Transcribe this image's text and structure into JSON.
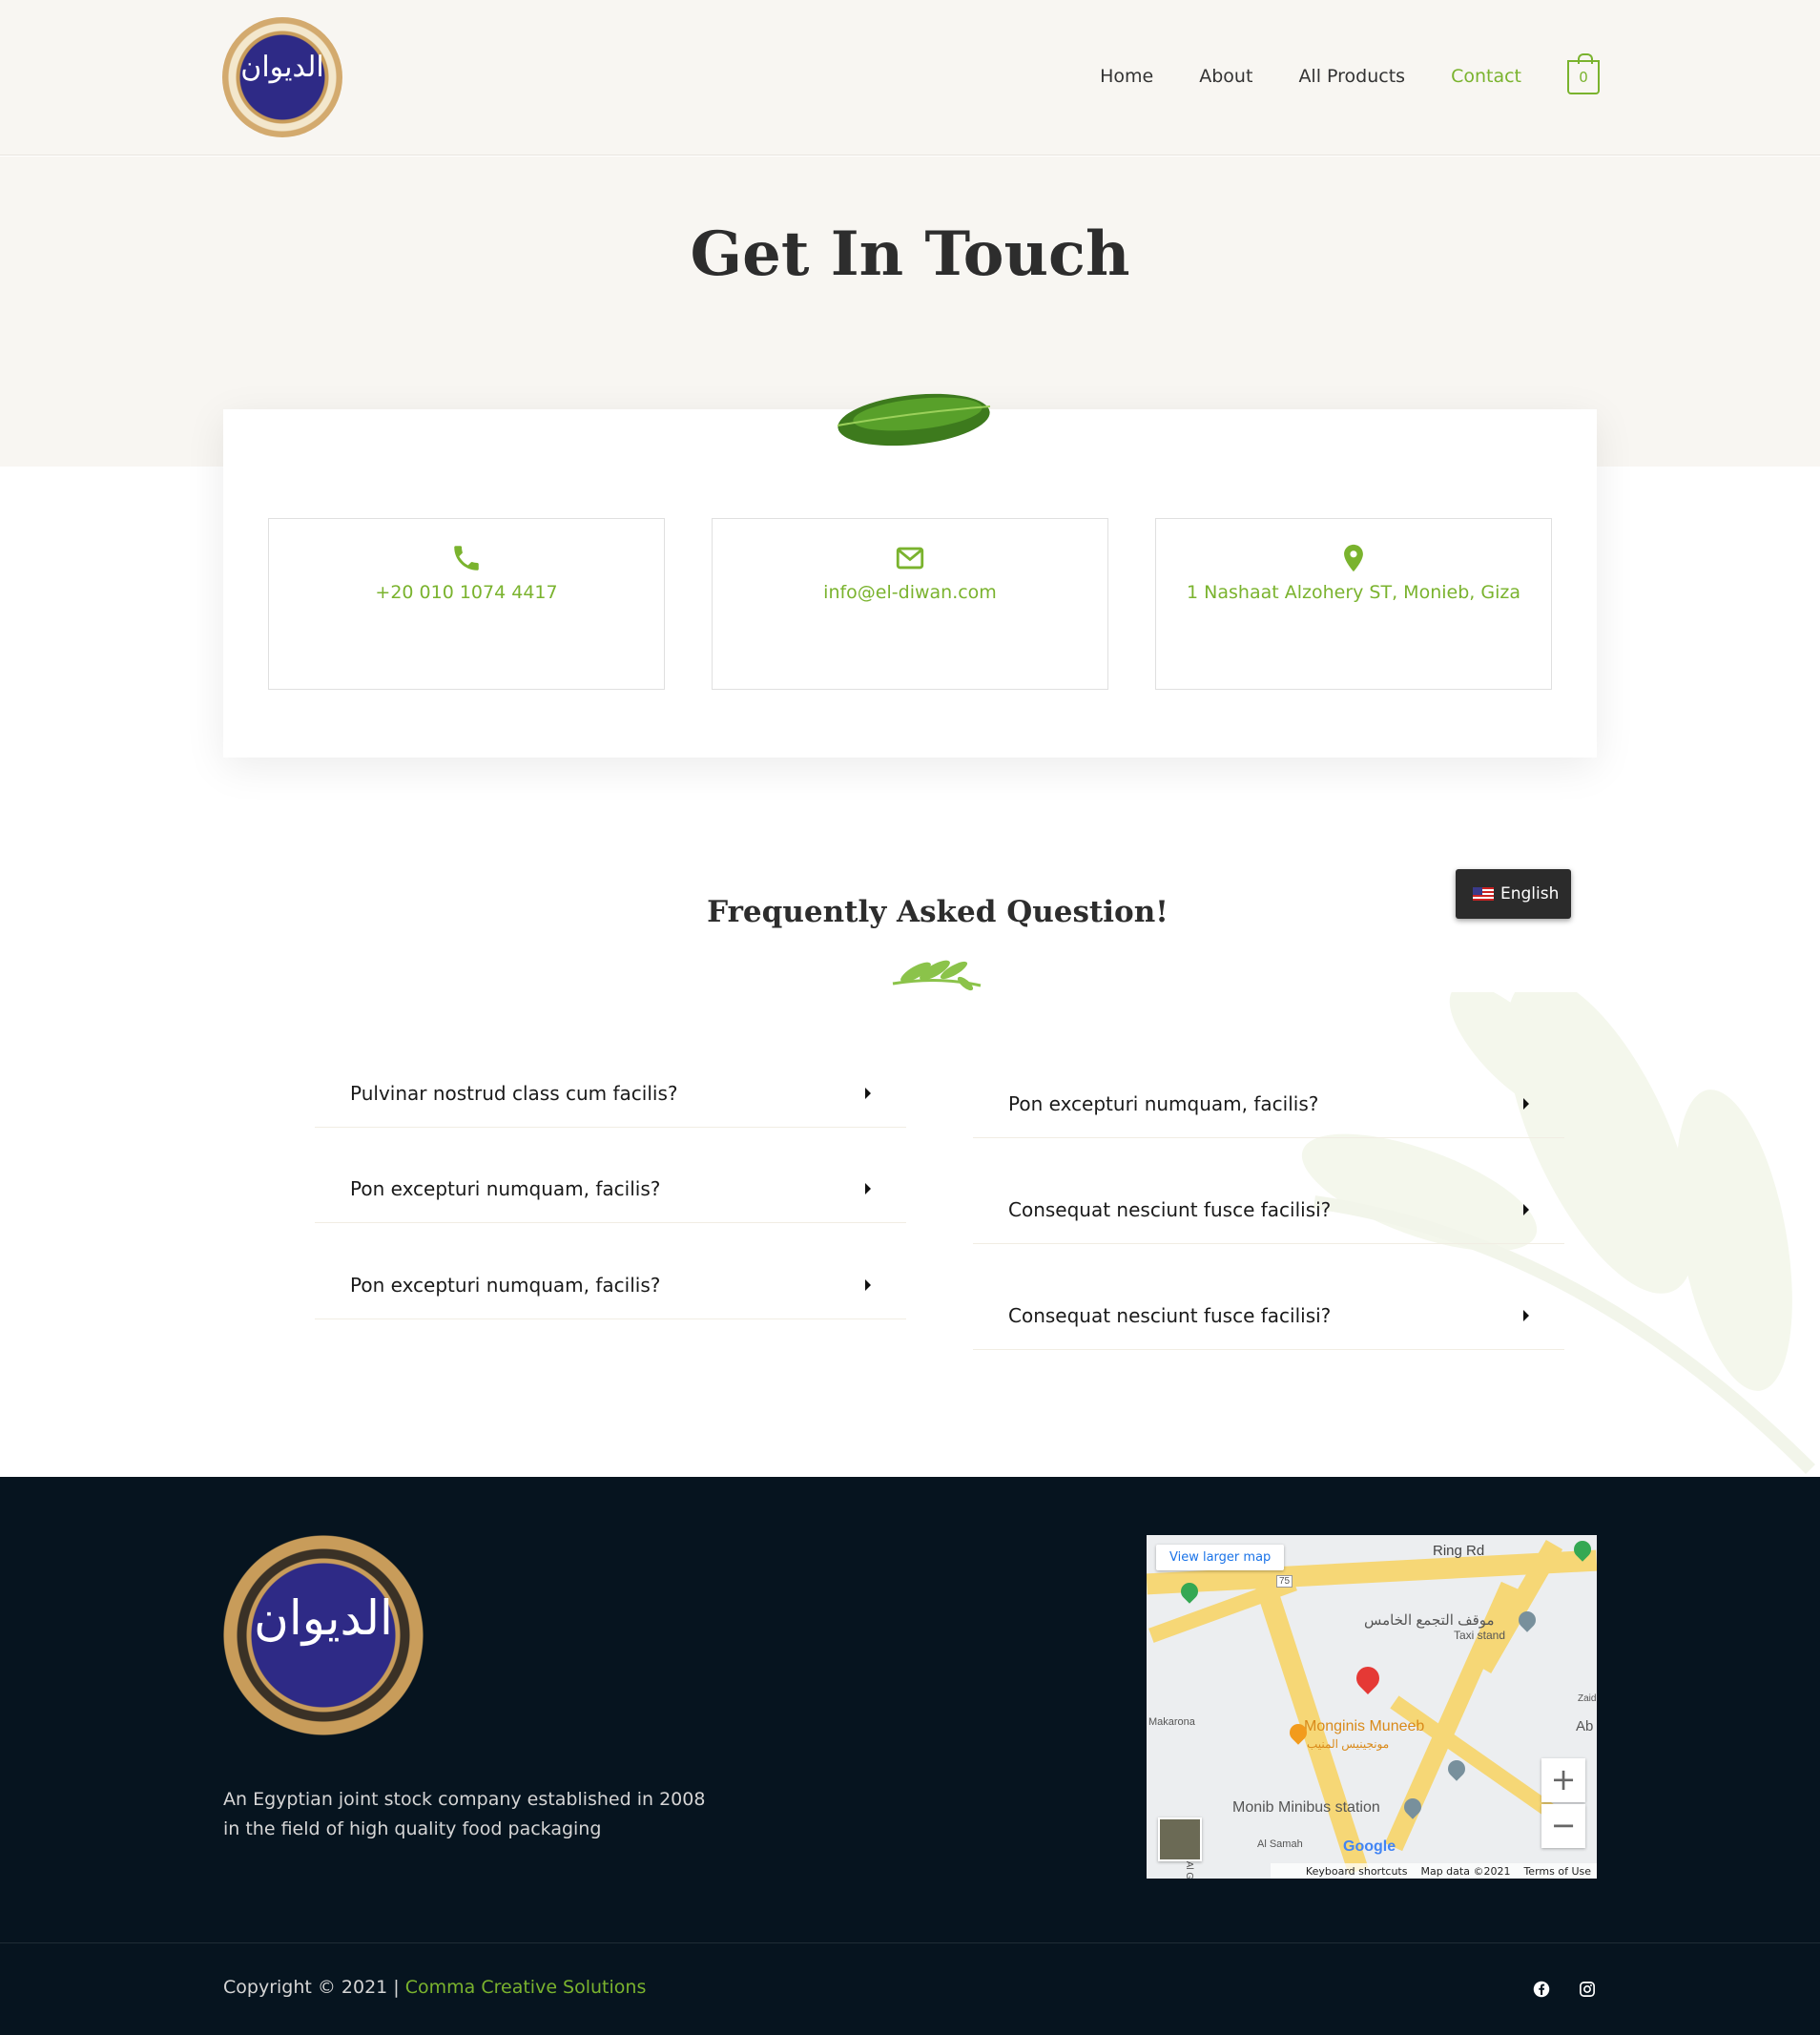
{
  "nav": {
    "items": [
      {
        "label": "Home"
      },
      {
        "label": "About"
      },
      {
        "label": "All Products"
      },
      {
        "label": "Contact"
      }
    ],
    "cart_count": "0"
  },
  "logo": {
    "text": "الديوان"
  },
  "hero": {
    "title": "Get In Touch"
  },
  "contact": {
    "phone": "+20 010 1074 4417",
    "email": "info@el-diwan.com",
    "address": "1 Nashaat Alzohery ST, Monieb, Giza"
  },
  "faq": {
    "title": "Frequently Asked Question!",
    "left": [
      "Pulvinar nostrud class cum facilis?",
      "Pon excepturi numquam, facilis?",
      "Pon excepturi numquam, facilis?"
    ],
    "right": [
      "Pon excepturi numquam, facilis?",
      "Consequat nesciunt fusce facilisi?",
      "Consequat nesciunt fusce facilisi?"
    ]
  },
  "language": {
    "label": "English"
  },
  "footer": {
    "description": "An Egyptian joint stock company established in 2008 in the field of high quality food packaging",
    "copyright_prefix": "Copyright © 2021 | ",
    "company": "Comma Creative Solutions",
    "map": {
      "view_larger": "View larger map",
      "ring_rd": "Ring Rd",
      "taxi_ar": "موقف التجمع الخامس",
      "taxi_stand": "Taxi stand",
      "monginis": "Monginis Muneeb",
      "monginis_ar": "مونجينيس المنيب",
      "minibus": "Monib Minibus station",
      "makarona": "Makarona",
      "al_samah": "Al Samah",
      "extent": "Extent of Al Gam",
      "ab": "Ab",
      "zaid": "Zaid",
      "route": "75",
      "zoom_in": "+",
      "zoom_out": "−",
      "google": "Google",
      "shortcuts": "Keyboard shortcuts",
      "map_data": "Map data ©2021",
      "terms": "Terms of Use"
    }
  },
  "colors": {
    "accent": "#7ab32e",
    "footer_bg": "#06141f",
    "hero_bg": "#f8f6f2"
  }
}
